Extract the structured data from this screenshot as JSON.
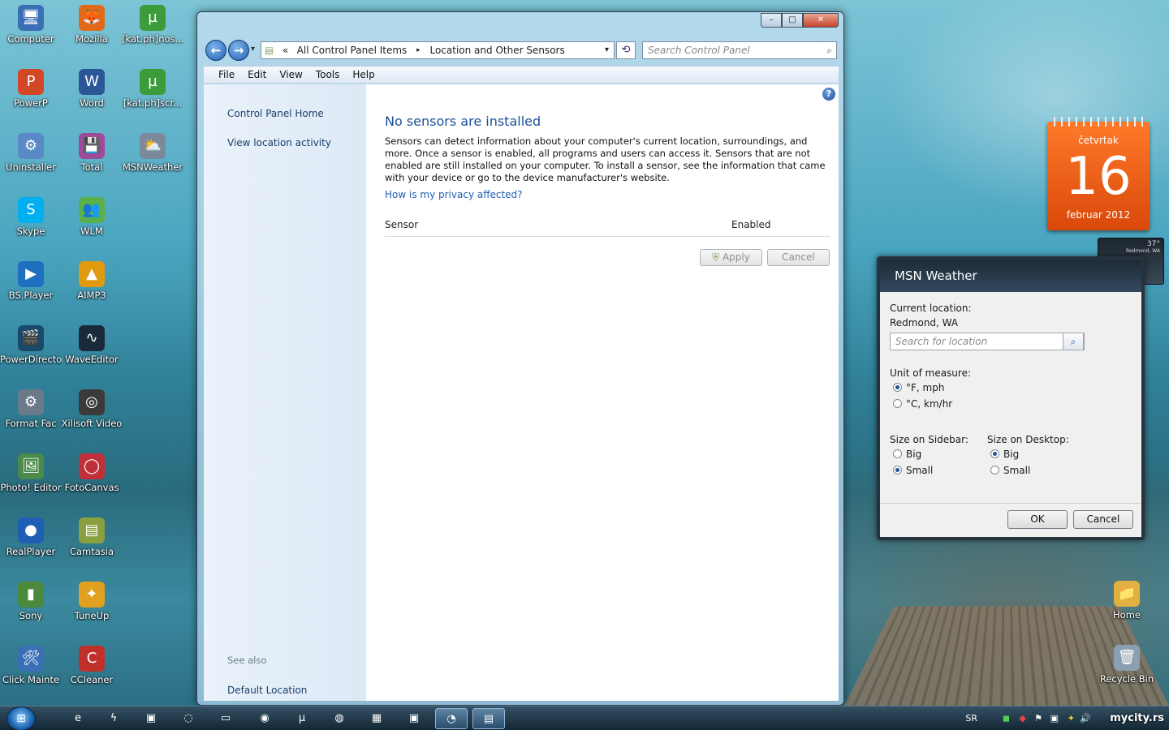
{
  "desktop": {
    "icons": [
      {
        "label": "Computer",
        "icon": "computer-icon",
        "glyph": "🖥",
        "color": "#3a6fb5"
      },
      {
        "label": "Mozilla",
        "icon": "firefox-icon",
        "glyph": "🦊",
        "color": "#e06a1a"
      },
      {
        "label": "[kat.ph]nos...",
        "icon": "utorrent-icon",
        "glyph": "µ",
        "color": "#3c9b3a"
      },
      {
        "label": "PowerP",
        "icon": "powerpoint-icon",
        "glyph": "P",
        "color": "#d24726"
      },
      {
        "label": "Word",
        "icon": "word-icon",
        "glyph": "W",
        "color": "#2b5797"
      },
      {
        "label": "[kat.ph]scr...",
        "icon": "utorrent-icon",
        "glyph": "µ",
        "color": "#3c9b3a"
      },
      {
        "label": "Uninstaller",
        "icon": "uninstaller-icon",
        "glyph": "⚙",
        "color": "#5a8ac6"
      },
      {
        "label": "Total",
        "icon": "floppy-icon",
        "glyph": "💾",
        "color": "#a04a9a"
      },
      {
        "label": "MSNWeather",
        "icon": "weather-icon",
        "glyph": "⛅",
        "color": "#7a8a9a"
      },
      {
        "label": "Skype",
        "icon": "skype-icon",
        "glyph": "S",
        "color": "#00aff0"
      },
      {
        "label": "WLM",
        "icon": "messenger-icon",
        "glyph": "👥",
        "color": "#5ab04a"
      },
      {
        "label": "BS.Player",
        "icon": "bsplayer-icon",
        "glyph": "▶",
        "color": "#1f6fc0"
      },
      {
        "label": "AIMP3",
        "icon": "aimp-icon",
        "glyph": "▲",
        "color": "#e09a10"
      },
      {
        "label": "PowerDirecto",
        "icon": "powerdirector-icon",
        "glyph": "🎬",
        "color": "#1a4a6a"
      },
      {
        "label": "WaveEditor",
        "icon": "waveeditor-icon",
        "glyph": "∿",
        "color": "#1a2a3a"
      },
      {
        "label": "Format Fac",
        "icon": "formatfactory-icon",
        "glyph": "⚙",
        "color": "#6a7a8a"
      },
      {
        "label": "Xilisoft Video",
        "icon": "film-reel-icon",
        "glyph": "◎",
        "color": "#3a3a3a"
      },
      {
        "label": "Photo! Editor",
        "icon": "photo-editor-icon",
        "glyph": "🖼",
        "color": "#4a8a4a"
      },
      {
        "label": "FotoCanvas",
        "icon": "fotocanvas-icon",
        "glyph": "◯",
        "color": "#c0303a"
      },
      {
        "label": "RealPlayer",
        "icon": "realplayer-icon",
        "glyph": "●",
        "color": "#1f5fb3"
      },
      {
        "label": "Camtasia",
        "icon": "camtasia-icon",
        "glyph": "▤",
        "color": "#8aa040"
      },
      {
        "label": "Sony",
        "icon": "sony-icon",
        "glyph": "▮",
        "color": "#4a8a3a"
      },
      {
        "label": "TuneUp",
        "icon": "tuneup-icon",
        "glyph": "✦",
        "color": "#e0a020"
      },
      {
        "label": "Click Mainte",
        "icon": "maintenance-icon",
        "glyph": "🛠",
        "color": "#3a6fb5"
      },
      {
        "label": "CCleaner",
        "icon": "ccleaner-icon",
        "glyph": "C",
        "color": "#c0302a"
      }
    ],
    "right_icons": [
      {
        "label": "Home",
        "icon": "folder-icon",
        "glyph": "📁",
        "color": "#e0b040"
      },
      {
        "label": "Recycle Bin",
        "icon": "recycle-bin-icon",
        "glyph": "🗑",
        "color": "#8aa0b0"
      }
    ]
  },
  "window": {
    "caption": {
      "minimize": "–",
      "maximize": "□",
      "close": "✕"
    },
    "nav": {
      "back": "←",
      "forward": "→",
      "dropdown": "▾"
    },
    "address": {
      "chevrons": "«",
      "crumbs": [
        "All Control Panel Items",
        "Location and Other Sensors"
      ],
      "separator": "▸",
      "dropdown": "▾"
    },
    "refresh": "⟲",
    "search_placeholder": "Search Control Panel",
    "search_icon": "⌕",
    "menu": [
      "File",
      "Edit",
      "View",
      "Tools",
      "Help"
    ],
    "left_pane": {
      "links": [
        "Control Panel Home",
        "View location activity"
      ],
      "see_also": "See also",
      "see_also_links": [
        "Default Location"
      ]
    },
    "main": {
      "help": "?",
      "title": "No sensors are installed",
      "description": "Sensors can detect information about your computer's current location, surroundings, and more. Once a sensor is enabled, all programs and users can access it. Sensors that are not enabled are still installed on your computer. To install a sensor, see the information that came with your device or go to the device manufacturer's website.",
      "privacy_link": "How is my privacy affected?",
      "columns": [
        "Sensor",
        "Enabled"
      ],
      "apply": "Apply",
      "cancel": "Cancel"
    }
  },
  "calendar": {
    "weekday": "četvrtak",
    "day": "16",
    "month_year": "februar 2012"
  },
  "weather_mini": {
    "temp": "37°",
    "place": "Redmond, WA"
  },
  "weather_dialog": {
    "title": "MSN Weather",
    "current_location_label": "Current location:",
    "current_location": "Redmond, WA",
    "search_placeholder": "Search for location",
    "search_icon": "⌕",
    "unit_label": "Unit of measure:",
    "units": [
      {
        "label": "°F, mph",
        "selected": true
      },
      {
        "label": "°C, km/hr",
        "selected": false
      }
    ],
    "sidebar_label": "Size on Sidebar:",
    "sidebar_sizes": [
      {
        "label": "Big",
        "selected": false
      },
      {
        "label": "Small",
        "selected": true
      }
    ],
    "desktop_label": "Size on Desktop:",
    "desktop_sizes": [
      {
        "label": "Big",
        "selected": true
      },
      {
        "label": "Small",
        "selected": false
      }
    ],
    "ok": "OK",
    "cancel": "Cancel"
  },
  "taskbar": {
    "start": "⊞",
    "items": [
      {
        "icon": "ie-icon",
        "glyph": "e"
      },
      {
        "icon": "lightning-icon",
        "glyph": "ϟ"
      },
      {
        "icon": "folder-icon",
        "glyph": "▣"
      },
      {
        "icon": "search-app-icon",
        "glyph": "◌"
      },
      {
        "icon": "monitor-icon",
        "glyph": "▭"
      },
      {
        "icon": "chrome-icon",
        "glyph": "◉"
      },
      {
        "icon": "utorrent-icon",
        "glyph": "µ"
      },
      {
        "icon": "globe-icon",
        "glyph": "◍"
      },
      {
        "icon": "film-icon",
        "glyph": "▦"
      },
      {
        "icon": "media-icon",
        "glyph": "▣"
      },
      {
        "icon": "firefox-icon",
        "glyph": "◔"
      },
      {
        "icon": "control-panel-icon",
        "glyph": "▤"
      }
    ],
    "language": "SR",
    "watermark": "mycity.rs"
  }
}
